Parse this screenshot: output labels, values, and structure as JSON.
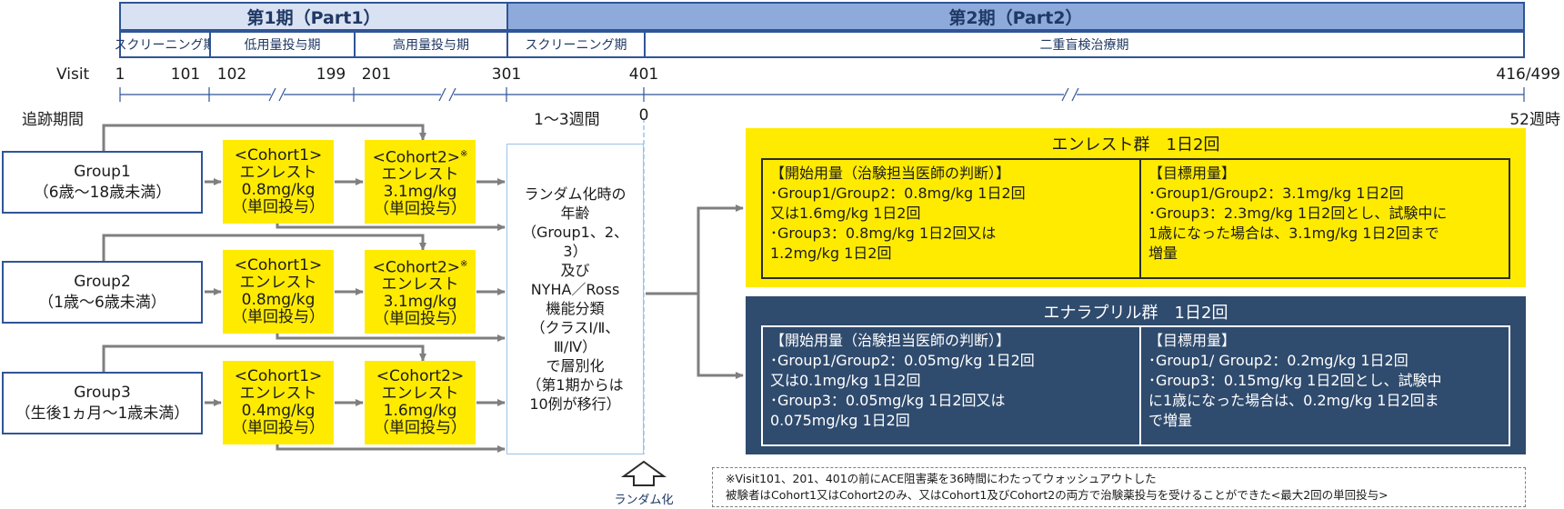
{
  "header": {
    "phase1": "第1期（Part1）",
    "phase2": "第2期（Part2）",
    "sub": [
      "スクリーニング期",
      "低用量投与期",
      "高用量投与期",
      "スクリーニング期",
      "二重盲検治療期"
    ]
  },
  "timeline": {
    "visit_label": "Visit",
    "visits": [
      "1",
      "101",
      "102",
      "199",
      "201",
      "301",
      "401",
      "416/499"
    ],
    "followup_label": "追跡期間",
    "weeks_label": "1〜3週間",
    "zero": "0",
    "end_label": "52週時"
  },
  "groups": [
    {
      "name": "Group1",
      "age": "（6歳〜18歳未満）"
    },
    {
      "name": "Group2",
      "age": "（1歳〜6歳未満）"
    },
    {
      "name": "Group3",
      "age": "（生後1ヵ月〜1歳未満）"
    }
  ],
  "cohorts": [
    {
      "c1": [
        "<Cohort1>",
        "エンレスト",
        "0.8mg/kg",
        "（単回投与）"
      ],
      "c2": [
        "<Cohort2>",
        "エンレスト",
        "3.1mg/kg",
        "（単回投与）"
      ],
      "c2_mark": "※"
    },
    {
      "c1": [
        "<Cohort1>",
        "エンレスト",
        "0.8mg/kg",
        "（単回投与）"
      ],
      "c2": [
        "<Cohort2>",
        "エンレスト",
        "3.1mg/kg",
        "（単回投与）"
      ],
      "c2_mark": "※"
    },
    {
      "c1": [
        "<Cohort1>",
        "エンレスト",
        "0.4mg/kg",
        "（単回投与）"
      ],
      "c2": [
        "<Cohort2>",
        "エンレスト",
        "1.6mg/kg",
        "（単回投与）"
      ],
      "c2_mark": ""
    }
  ],
  "randomization": {
    "lines": [
      "ランダム化時の",
      "年齢",
      "（Group1、2、",
      "3）",
      "及び",
      "NYHA／Ross",
      "機能分類",
      "（クラスⅠ/Ⅱ、",
      "Ⅲ/Ⅳ）",
      "で層別化",
      "（第1期からは",
      "10例が移行）"
    ],
    "arrow_label": "ランダム化"
  },
  "arms": [
    {
      "title": "エンレスト群　1日2回",
      "start_title": "【開始用量（治験担当医師の判断）】",
      "start_lines": [
        "･Group1/Group2：0.8mg/kg 1日2回",
        "  又は1.6mg/kg 1日2回",
        "･Group3：0.8mg/kg 1日2回又は",
        "  1.2mg/kg 1日2回"
      ],
      "target_title": "【目標用量】",
      "target_lines": [
        "･Group1/Group2：3.1mg/kg 1日2回",
        "･Group3：2.3mg/kg 1日2回とし、試験中に",
        "  1歳になった場合は、3.1mg/kg 1日2回まで",
        "  増量"
      ]
    },
    {
      "title": "エナラプリル群　1日2回",
      "start_title": "【開始用量（治験担当医師の判断）】",
      "start_lines": [
        "･Group1/Group2：0.05mg/kg 1日2回",
        "  又は0.1mg/kg 1日2回",
        "･Group3：0.05mg/kg 1日2回又は",
        "  0.075mg/kg 1日2回"
      ],
      "target_title": "【目標用量】",
      "target_lines": [
        "･Group1/ Group2：0.2mg/kg 1日2回",
        "･Group3：0.15mg/kg 1日2回とし、試験中",
        "  に1歳になった場合は、0.2mg/kg 1日2回ま",
        "  で増量"
      ]
    }
  ],
  "note": [
    "※Visit101、201、401の前にACE阻害薬を36時間にわたってウォッシュアウトした",
    "被験者はCohort1又はCohort2のみ、又はCohort1及びCohort2の両方で治験薬投与を受けることができた<最大2回の単回投与>"
  ],
  "colors": {
    "navy": "#2f5597",
    "yellow": "#ffeb00",
    "dark_blue": "#2f4b6e",
    "light_blue": "#d9e2f3",
    "mid_blue": "#8eaadb",
    "arrow_gray": "#7f7f7f"
  }
}
